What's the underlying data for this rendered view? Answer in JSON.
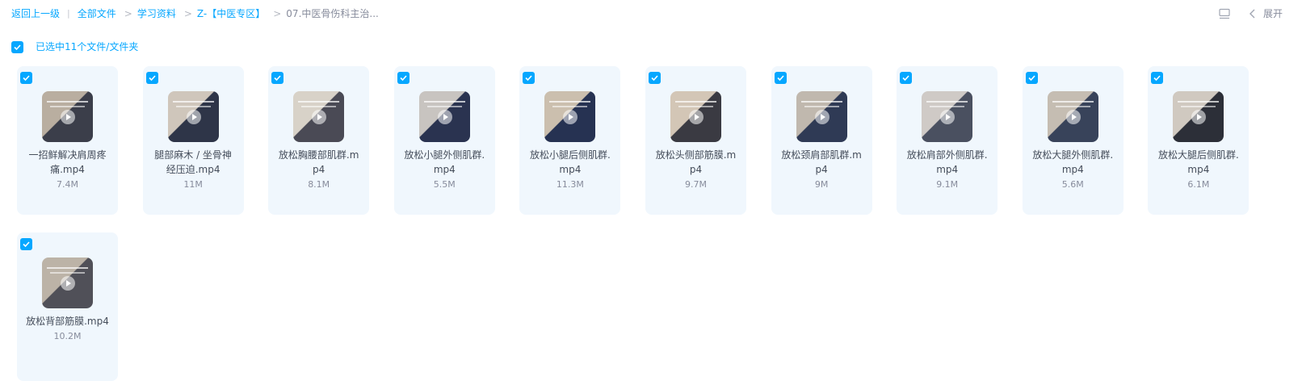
{
  "breadcrumb": {
    "back_label": "返回上一级",
    "items": [
      {
        "label": "全部文件"
      },
      {
        "label": "学习资料"
      },
      {
        "label": "Z-【中医专区】"
      },
      {
        "label": "07.中医骨伤科主治..."
      }
    ]
  },
  "toolbar": {
    "layout_icon": "layout-icon",
    "expand_icon": "chevron-left-icon",
    "expand_label": "展开"
  },
  "selection": {
    "checked": true,
    "label": "已选中11个文件/文件夹"
  },
  "files": [
    {
      "name_line1": "一招鲜解决肩周疼",
      "name_line2": "痛.mp4",
      "size": "7.4M",
      "checked": true
    },
    {
      "name_line1": "腿部麻木 / 坐骨神",
      "name_line2": "经压迫.mp4",
      "size": "11M",
      "checked": true
    },
    {
      "name_line1": "放松胸腰部肌群.m",
      "name_line2": "p4",
      "size": "8.1M",
      "checked": true
    },
    {
      "name_line1": "放松小腿外侧肌群.",
      "name_line2": "mp4",
      "size": "5.5M",
      "checked": true
    },
    {
      "name_line1": "放松小腿后侧肌群.",
      "name_line2": "mp4",
      "size": "11.3M",
      "checked": true
    },
    {
      "name_line1": "放松头侧部筋膜.m",
      "name_line2": "p4",
      "size": "9.7M",
      "checked": true
    },
    {
      "name_line1": "放松颈肩部肌群.m",
      "name_line2": "p4",
      "size": "9M",
      "checked": true
    },
    {
      "name_line1": "放松肩部外侧肌群.",
      "name_line2": "mp4",
      "size": "9.1M",
      "checked": true
    },
    {
      "name_line1": "放松大腿外侧肌群.",
      "name_line2": "mp4",
      "size": "5.6M",
      "checked": true
    },
    {
      "name_line1": "放松大腿后侧肌群.",
      "name_line2": "mp4",
      "size": "6.1M",
      "checked": true
    },
    {
      "name_line1": "放松背部筋膜.mp4",
      "name_line2": "",
      "size": "10.2M",
      "checked": true
    }
  ]
}
